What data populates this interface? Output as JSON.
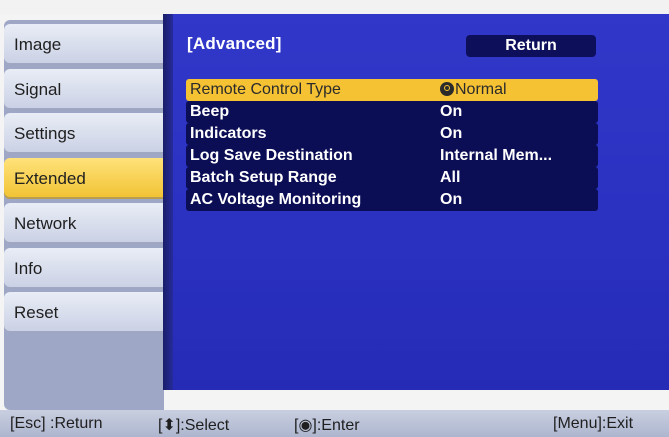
{
  "sidebar": {
    "items": [
      {
        "label": "Image"
      },
      {
        "label": "Signal"
      },
      {
        "label": "Settings"
      },
      {
        "label": "Extended"
      },
      {
        "label": "Network"
      },
      {
        "label": "Info"
      },
      {
        "label": "Reset"
      }
    ],
    "active_label": "Extended"
  },
  "panel": {
    "title": "[Advanced]",
    "return_label": "Return",
    "rows": [
      {
        "label": "Remote Control Type",
        "value": "Normal"
      },
      {
        "label": "Beep",
        "value": "On"
      },
      {
        "label": "Indicators",
        "value": "On"
      },
      {
        "label": "Log Save Destination",
        "value": "Internal Mem..."
      },
      {
        "label": "Batch Setup Range",
        "value": "All"
      },
      {
        "label": "AC Voltage Monitoring",
        "value": "On"
      }
    ]
  },
  "help_bar": {
    "esc": "[Esc] :Return",
    "select": "[⬍]:Select",
    "enter": "[◉]:Enter",
    "menu": "[Menu]:Exit"
  },
  "colors": {
    "panel_blue": "#2f35c6",
    "highlight_yellow": "#f5c233",
    "row_navy": "#0b0d55"
  }
}
